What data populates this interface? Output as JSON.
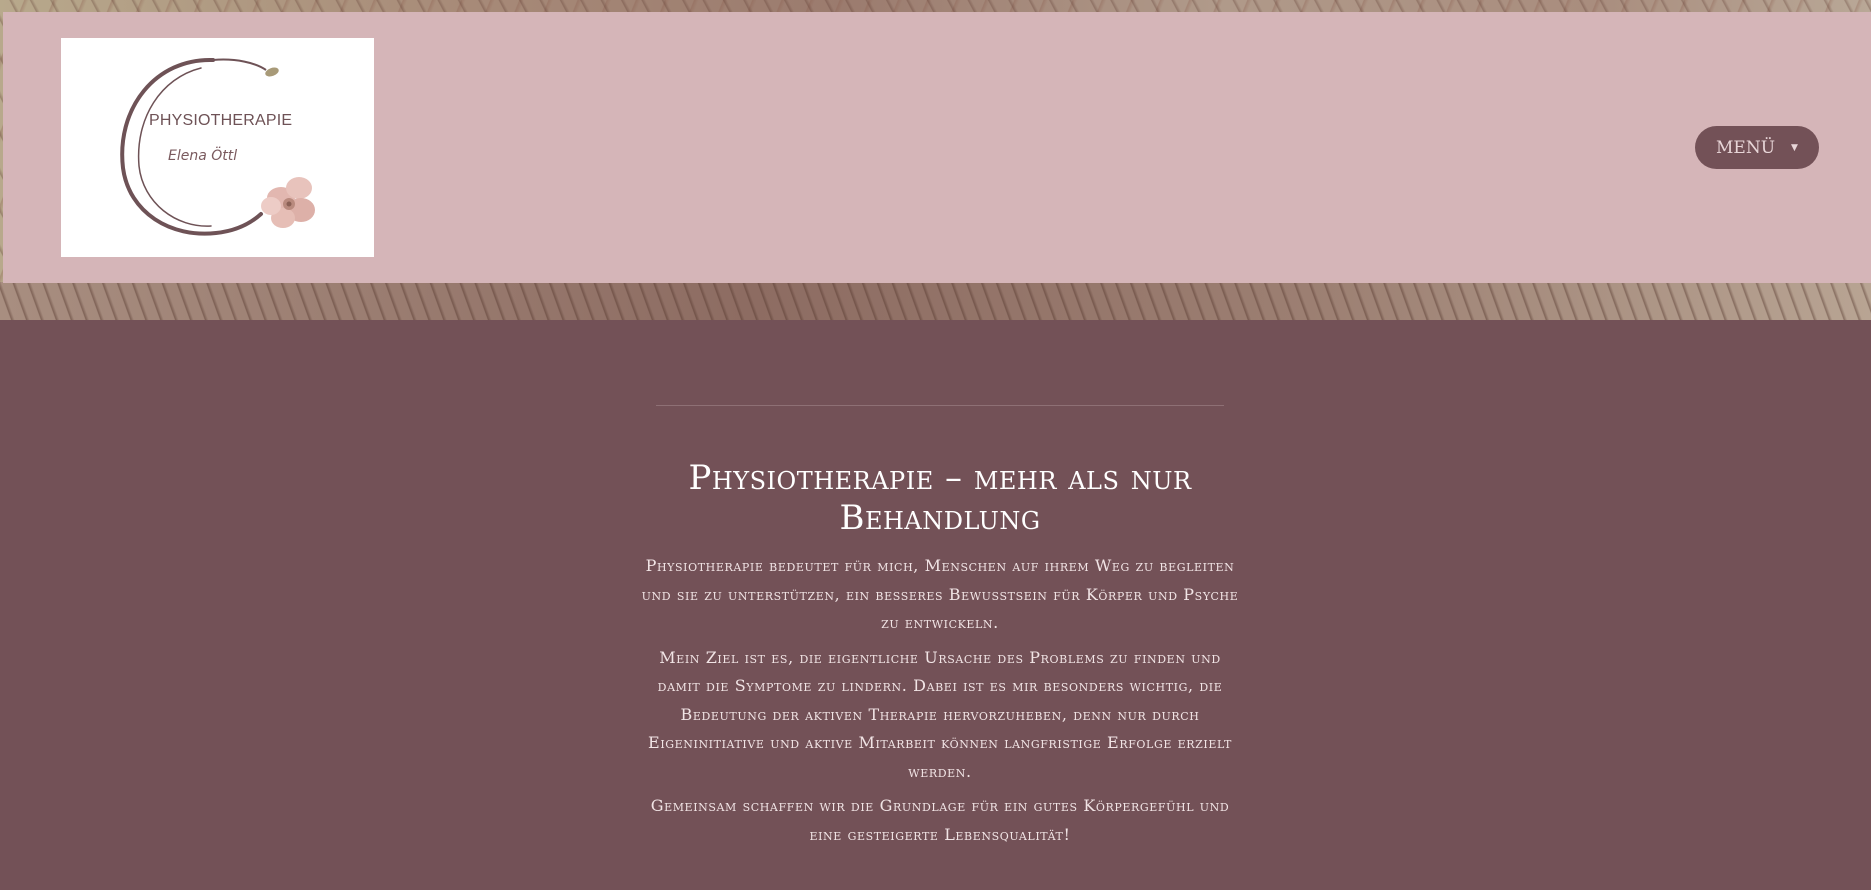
{
  "header": {
    "logo": {
      "title": "PHYSIOTHERAPIE",
      "name": "Elena Öttl"
    },
    "menu_label": "MENÜ",
    "menu_icon": "caret-down-icon"
  },
  "hero": {
    "scroll_icon": "chevron-down-icon"
  },
  "main": {
    "headline": "Physiotherapie – mehr als nur Behandlung",
    "paragraphs": [
      "Physiotherapie bedeutet für mich, Menschen auf ihrem Weg zu begleiten und sie zu unterstützen, ein besseres Bewusstsein für Körper und Psyche zu entwickeln.",
      "Mein Ziel ist es, die eigentliche Ursache des Problems zu finden und damit die Symptome zu lindern. Dabei ist es mir besonders wichtig, die Bedeutung der aktiven Therapie hervorzuheben, denn nur durch Eigeninitiative und aktive Mitarbeit können langfristige Erfolge erzielt werden.",
      "Gemeinsam schaffen wir die Grundlage für ein gutes Körpergefühl und eine gesteigerte Lebensqualität!"
    ]
  },
  "colors": {
    "header_bg": "#d5b5b8",
    "main_bg": "#735157",
    "menu_bg": "#735157",
    "text": "#f3e7e8"
  }
}
